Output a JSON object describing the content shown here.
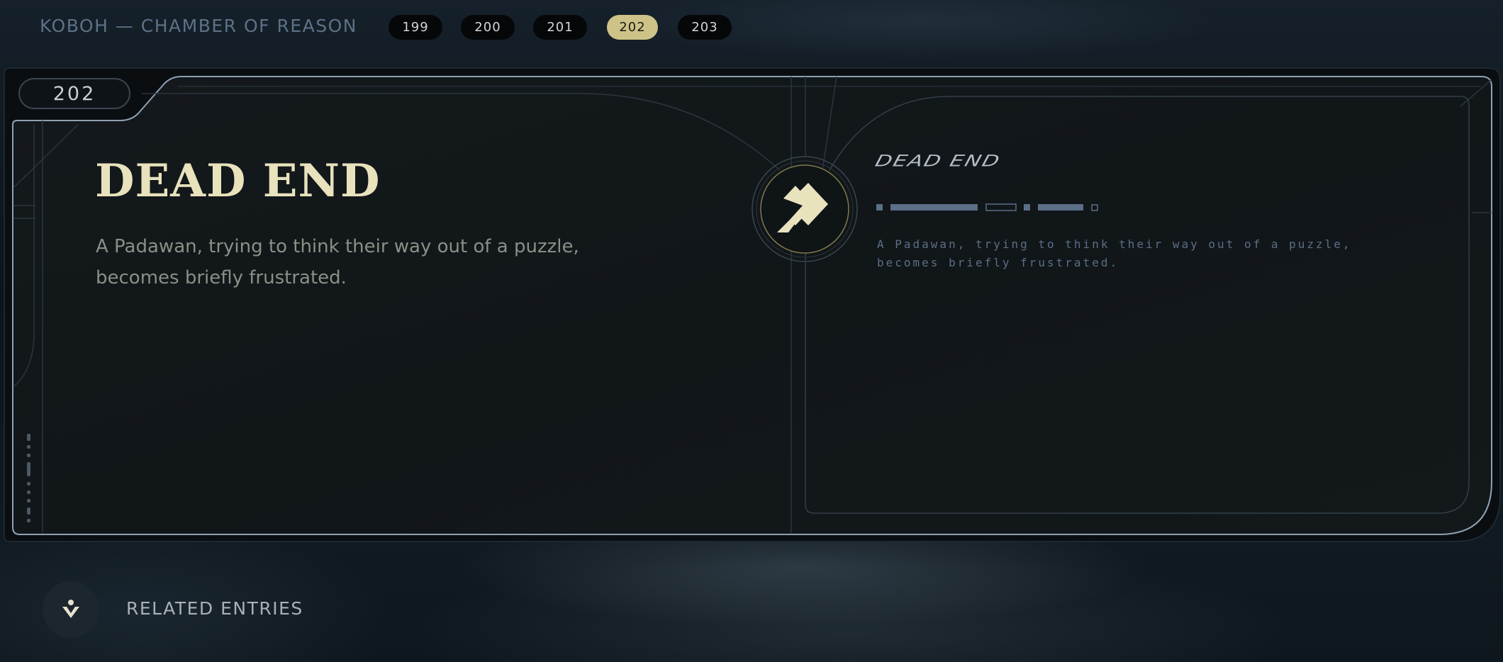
{
  "header": {
    "location": "KOBOH — CHAMBER OF REASON",
    "pages": [
      {
        "label": "199",
        "active": false
      },
      {
        "label": "200",
        "active": false
      },
      {
        "label": "201",
        "active": false
      },
      {
        "label": "202",
        "active": true
      },
      {
        "label": "203",
        "active": false
      }
    ]
  },
  "entry": {
    "number": "202",
    "title": "DEAD END",
    "description": "A Padawan, trying to think their way out of a puzzle, becomes briefly frustrated.",
    "aurebesh_title": "DEAD END",
    "aurebesh_text": "A Padawan, trying to think their way out of a puzzle, becomes briefly frustrated.",
    "emblem_icon": "databank-emblem-icon"
  },
  "footer": {
    "related_label": "RELATED ENTRIES",
    "related_icon": "related-entries-icon"
  },
  "colors": {
    "accent_gold": "#cdc388",
    "title_cream": "#e8e2bd",
    "frame_line": "#8fa1b3",
    "aurebesh_blue": "#5b6f86"
  }
}
